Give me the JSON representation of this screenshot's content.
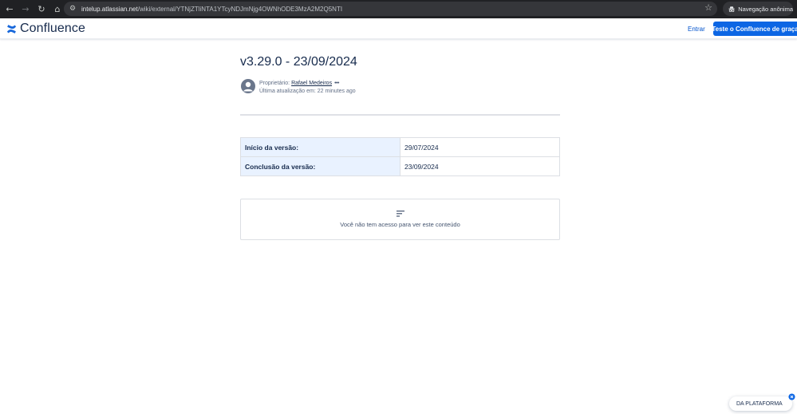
{
  "browser": {
    "url_host": "intelup.atlassian.net",
    "url_path": "/wiki/external/YTNjZTliNTA1YTcyNDJmNjg4OWNhODE3MzA2M2Q5NTI",
    "incognito_label": "Navegação anônima",
    "icons": [
      "back-arrow-icon",
      "forward-arrow-icon",
      "reload-icon",
      "home-icon",
      "site-info-icon",
      "star-icon",
      "incognito-icon"
    ]
  },
  "header": {
    "logo_text": "Confluence",
    "login_label": "Entrar",
    "try_label": "Teste o Confluence de graça",
    "brand_color": "#0c66e4"
  },
  "page": {
    "title": "v3.29.0 - 23/09/2024",
    "owner_prefix": "Proprietário:",
    "owner_name": "Rafael Medeiros",
    "more_label": "•••",
    "updated_text": "Última atualização em: 22 minutes ago"
  },
  "table": {
    "rows": [
      {
        "label": "Início da versão:",
        "value": "29/07/2024"
      },
      {
        "label": "Conclusão da versão:",
        "value": "23/09/2024"
      }
    ]
  },
  "restricted": {
    "message": "Você não tem acesso para ver este conteúdo"
  },
  "platform_chip": {
    "label": "DA PLATAFORMA"
  }
}
